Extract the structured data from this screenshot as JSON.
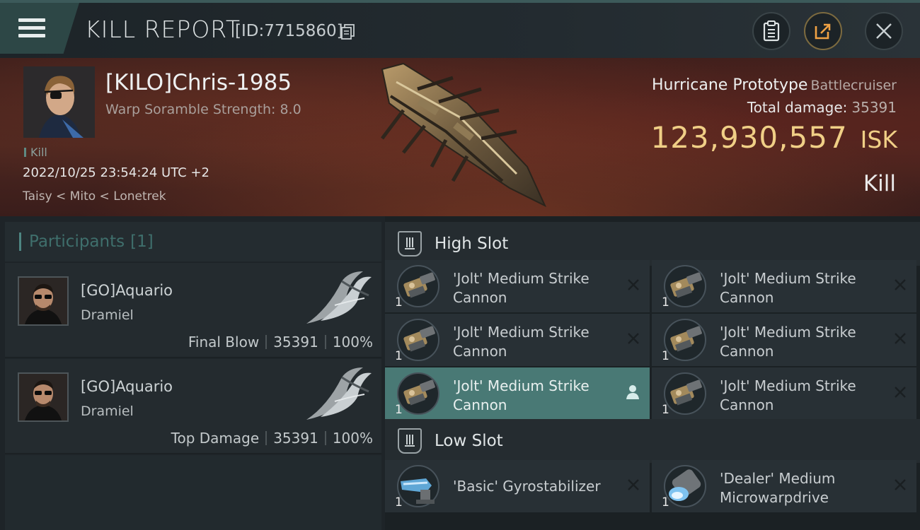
{
  "header": {
    "title": "KILL REPORT",
    "report_id": "[ID:7715860]"
  },
  "victim": {
    "name": "[KILO]Chris-1985",
    "warp_scramble": "Warp Soramble Strength: 8.0",
    "kill_tag": "Kill",
    "datetime": "2022/10/25 23:54:24 UTC +2",
    "location": "Taisy < Mito < Lonetrek",
    "ship_name": "Hurricane Prototype",
    "ship_class": "Battlecruiser",
    "total_damage_label": "Total damage:",
    "total_damage": "35391",
    "isk_value": "123,930,557",
    "isk_unit": "ISK",
    "status": "Kill"
  },
  "participants": {
    "label": "Participants",
    "count": "[1]",
    "rows": [
      {
        "name": "[GO]Aquario",
        "corp": "Dramiel",
        "role": "Final Blow",
        "damage": "35391",
        "percent": "100%"
      },
      {
        "name": "[GO]Aquario",
        "corp": "Dramiel",
        "role": "Top Damage",
        "damage": "35391",
        "percent": "100%"
      }
    ]
  },
  "fittings": {
    "high_slot": {
      "label": "High Slot",
      "modules": [
        {
          "name": "'Jolt' Medium Strike Cannon",
          "qty": "1"
        },
        {
          "name": "'Jolt' Medium Strike Cannon",
          "qty": "1"
        },
        {
          "name": "'Jolt' Medium Strike Cannon",
          "qty": "1"
        },
        {
          "name": "'Jolt' Medium Strike Cannon",
          "qty": "1"
        },
        {
          "name": "'Jolt' Medium Strike Cannon",
          "qty": "1"
        },
        {
          "name": "'Jolt' Medium Strike Cannon",
          "qty": "1"
        }
      ]
    },
    "low_slot": {
      "label": "Low Slot",
      "modules": [
        {
          "name": "'Basic' Gyrostabilizer",
          "qty": "1"
        },
        {
          "name": "'Dealer' Medium Microwarpdrive",
          "qty": "1"
        }
      ]
    }
  },
  "colors": {
    "accent_teal": "#497975",
    "isk_gold": "#f0cf86",
    "panel_dark": "#242b2f"
  }
}
